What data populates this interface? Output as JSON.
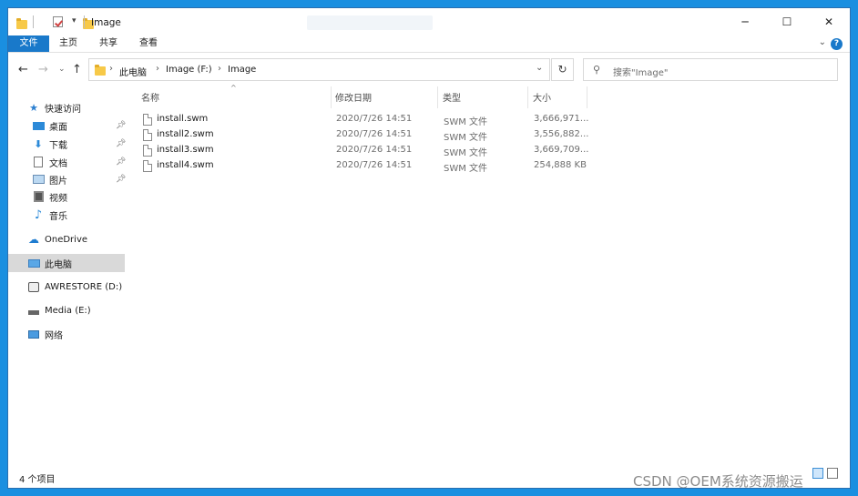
{
  "window": {
    "title": "Image"
  },
  "ribbon": {
    "tabs": [
      "文件",
      "主页",
      "共享",
      "查看"
    ]
  },
  "address": {
    "crumbs": [
      "此电脑",
      "Image (F:)",
      "Image"
    ]
  },
  "search": {
    "placeholder": "搜索\"Image\""
  },
  "sidebar": {
    "quick_access": "快速访问",
    "quick_items": [
      "桌面",
      "下载",
      "文档",
      "图片",
      "视频",
      "音乐"
    ],
    "onedrive": "OneDrive",
    "this_pc": "此电脑",
    "drive_d": "AWRESTORE (D:)",
    "drive_e": "Media (E:)",
    "network": "网络"
  },
  "columns": {
    "name": "名称",
    "date": "修改日期",
    "type": "类型",
    "size": "大小"
  },
  "files": [
    {
      "name": "install.swm",
      "date": "2020/7/26 14:51",
      "type": "SWM 文件",
      "size": "3,666,971..."
    },
    {
      "name": "install2.swm",
      "date": "2020/7/26 14:51",
      "type": "SWM 文件",
      "size": "3,556,882..."
    },
    {
      "name": "install3.swm",
      "date": "2020/7/26 14:51",
      "type": "SWM 文件",
      "size": "3,669,709..."
    },
    {
      "name": "install4.swm",
      "date": "2020/7/26 14:51",
      "type": "SWM 文件",
      "size": "254,888 KB"
    }
  ],
  "status": {
    "item_count": "4 个项目"
  },
  "watermark": "CSDN @OEM系统资源搬运"
}
